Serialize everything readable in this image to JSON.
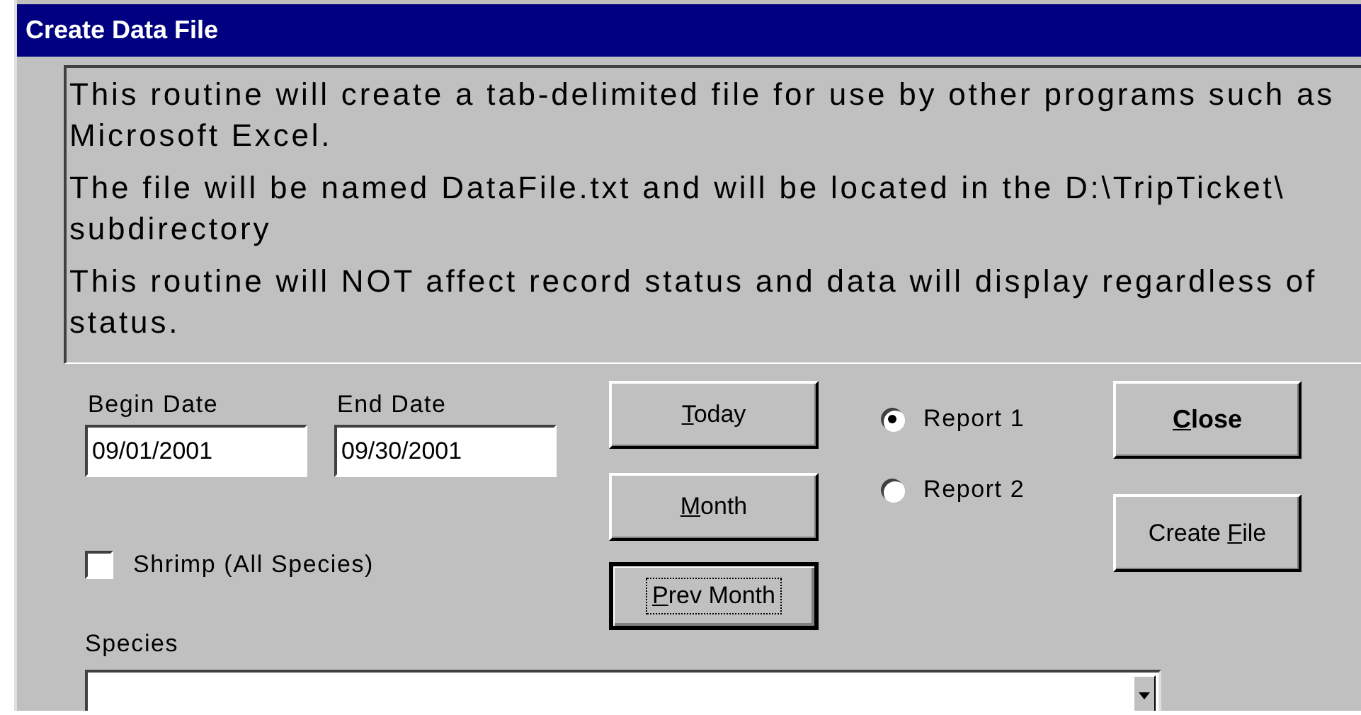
{
  "window": {
    "title": "Create Data File"
  },
  "message": {
    "paragraphs": [
      "This routine will create a tab-delimited file for use by other programs such as Microsoft Excel.",
      "The file will be named DataFile.txt and will be located in the D:\\TripTicket\\ subdirectory",
      "This routine will NOT affect record status and data will display regardless of status."
    ]
  },
  "dates": [
    {
      "label": "Begin Date",
      "value": "09/01/2001"
    },
    {
      "label": "End Date",
      "value": "09/30/2001"
    }
  ],
  "shrimp_checkbox": {
    "label": "Shrimp (All Species)",
    "checked": false
  },
  "range_buttons": [
    {
      "access_key": "T",
      "label_post": "oday",
      "default": false
    },
    {
      "access_key": "M",
      "label_post": "onth",
      "default": false
    },
    {
      "access_key": "P",
      "label_post": "rev Month",
      "default": true
    }
  ],
  "reports": [
    {
      "label": "Report 1",
      "selected": true
    },
    {
      "label": "Report 2",
      "selected": false
    }
  ],
  "action_buttons": [
    {
      "access_key": "C",
      "label_post": "lose",
      "bold": true
    },
    {
      "label_pre": "Create ",
      "access_key": "F",
      "label_post": "ile",
      "bold": false
    }
  ],
  "species": {
    "label": "Species"
  }
}
